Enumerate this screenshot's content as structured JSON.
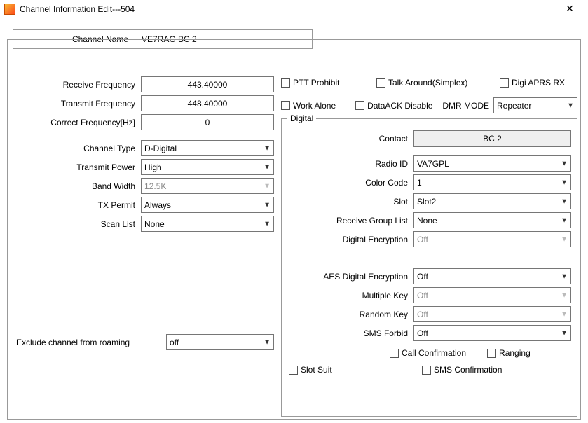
{
  "window": {
    "title": "Channel Information Edit---504",
    "channel_name_label": "Channel Name",
    "channel_name": "VE7RAG BC 2"
  },
  "left": {
    "rx_freq_label": "Receive Frequency",
    "rx_freq": "443.40000",
    "tx_freq_label": "Transmit Frequency",
    "tx_freq": "448.40000",
    "corr_freq_label": "Correct Frequency[Hz]",
    "corr_freq": "0",
    "ch_type_label": "Channel Type",
    "ch_type": "D-Digital",
    "tx_power_label": "Transmit Power",
    "tx_power": "High",
    "bw_label": "Band Width",
    "bw": "12.5K",
    "tx_permit_label": "TX Permit",
    "tx_permit": "Always",
    "scan_list_label": "Scan List",
    "scan_list": "None",
    "exclude_label": "Exclude channel from roaming",
    "exclude": "off"
  },
  "flags": {
    "ptt_prohibit": "PTT Prohibit",
    "talk_around": "Talk Around(Simplex)",
    "digi_aprs_rx": "Digi APRS RX",
    "work_alone": "Work Alone",
    "dataack_disable": "DataACK Disable",
    "dmr_mode_label": "DMR MODE",
    "dmr_mode": "Repeater"
  },
  "digital": {
    "legend": "Digital",
    "contact_label": "Contact",
    "contact": "BC 2",
    "radio_id_label": "Radio ID",
    "radio_id": "VA7GPL",
    "color_code_label": "Color Code",
    "color_code": "1",
    "slot_label": "Slot",
    "slot": "Slot2",
    "rx_group_label": "Receive Group List",
    "rx_group": "None",
    "dig_enc_label": "Digital Encryption",
    "dig_enc": "Off",
    "aes_enc_label": "AES Digital Encryption",
    "aes_enc": "Off",
    "multi_key_label": "Multiple Key",
    "multi_key": "Off",
    "random_key_label": "Random Key",
    "random_key": "Off",
    "sms_forbid_label": "SMS Forbid",
    "sms_forbid": "Off",
    "call_conf": "Call Confirmation",
    "ranging": "Ranging",
    "slot_suit": "Slot Suit",
    "sms_conf": "SMS Confirmation"
  }
}
